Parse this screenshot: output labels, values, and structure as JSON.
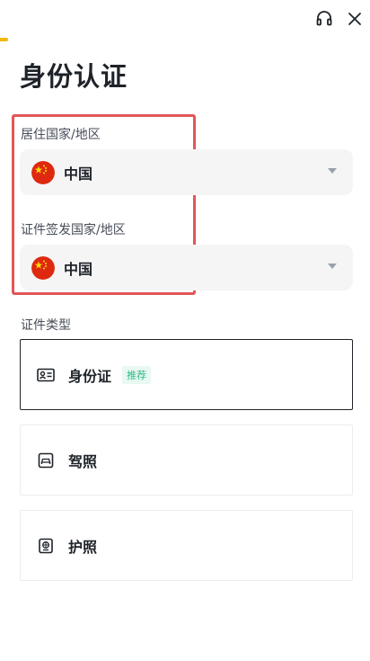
{
  "header": {
    "support_icon": "headset-icon",
    "close_icon": "close-icon",
    "accent_color": "#f0b90b"
  },
  "page": {
    "title": "身份认证"
  },
  "residence": {
    "label": "居住国家/地区",
    "value": "中国",
    "flag_icon": "china-flag-icon"
  },
  "issuing": {
    "label": "证件签发国家/地区",
    "value": "中国",
    "flag_icon": "china-flag-icon"
  },
  "document_type": {
    "label": "证件类型",
    "options": [
      {
        "label": "身份证",
        "badge": "推荐",
        "icon": "id-card-icon",
        "selected": true
      },
      {
        "label": "驾照",
        "icon": "driver-license-icon",
        "selected": false
      },
      {
        "label": "护照",
        "icon": "passport-icon",
        "selected": false
      }
    ]
  },
  "colors": {
    "highlight": "#e25656",
    "badge_text": "#2ebd85",
    "badge_bg": "#eaf8f2",
    "field_bg": "#f5f5f5"
  }
}
